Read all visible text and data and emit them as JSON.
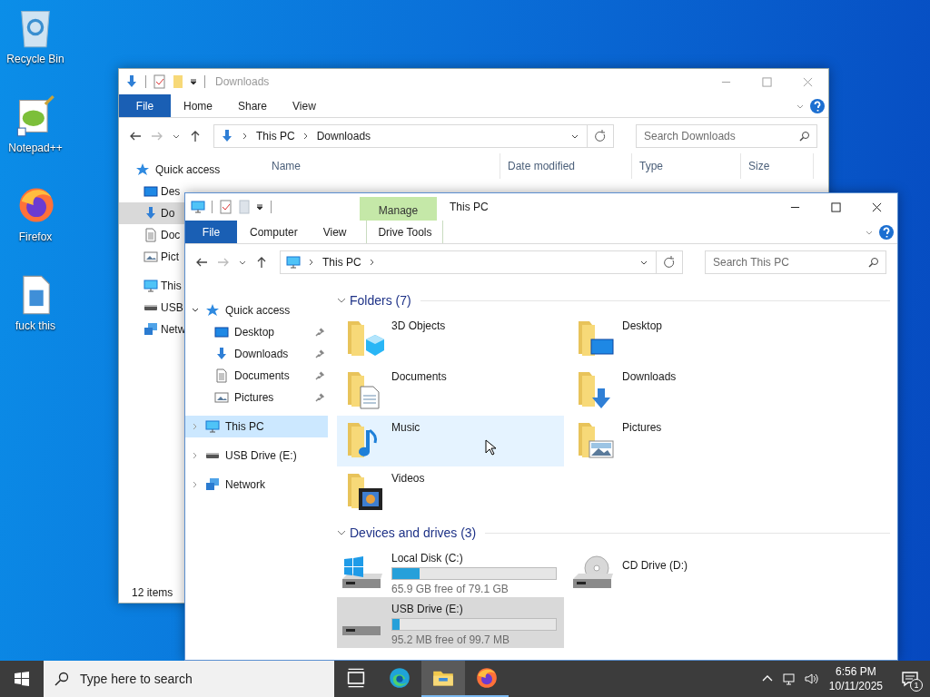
{
  "desktop_icons": [
    {
      "label": "Recycle Bin",
      "kind": "recycle"
    },
    {
      "label": "Notepad++",
      "kind": "notepad"
    },
    {
      "label": "Firefox",
      "kind": "firefox"
    },
    {
      "label": "fuck this",
      "kind": "file"
    }
  ],
  "back_window": {
    "title": "Downloads",
    "ribbon_tabs": [
      "File",
      "Home",
      "Share",
      "View"
    ],
    "address": [
      "This PC",
      "Downloads"
    ],
    "search": {
      "placeholder": "Search Downloads"
    },
    "columns": [
      "Name",
      "Date modified",
      "Type",
      "Size"
    ],
    "nav": [
      {
        "label": "Quick access",
        "kind": "star",
        "selected": false
      },
      {
        "label": "Des",
        "kind": "desktop",
        "selected": false
      },
      {
        "label": "Do",
        "kind": "download",
        "selected": true
      },
      {
        "label": "Doc",
        "kind": "document",
        "selected": false
      },
      {
        "label": "Pict",
        "kind": "picture",
        "selected": false
      },
      {
        "label": "This",
        "kind": "pc",
        "selected": false
      },
      {
        "label": "USB",
        "kind": "usb",
        "selected": false
      },
      {
        "label": "Netw",
        "kind": "network",
        "selected": false
      }
    ],
    "status": "12 items"
  },
  "front_window": {
    "title": "This PC",
    "context_group": "Manage",
    "ribbon_tabs": [
      "File",
      "Computer",
      "View"
    ],
    "context_tab": "Drive Tools",
    "address": [
      "This PC"
    ],
    "search": {
      "placeholder": "Search This PC"
    },
    "nav": [
      {
        "label": "Quick access",
        "kind": "star",
        "selected": false,
        "expanded": true,
        "children": [
          {
            "label": "Desktop",
            "kind": "desktop",
            "selected": false,
            "pinned": true
          },
          {
            "label": "Downloads",
            "kind": "download",
            "selected": false,
            "pinned": true
          },
          {
            "label": "Documents",
            "kind": "document",
            "selected": false,
            "pinned": true
          },
          {
            "label": "Pictures",
            "kind": "picture",
            "selected": false,
            "pinned": true
          }
        ]
      },
      {
        "label": "This PC",
        "kind": "pc",
        "selected": true,
        "expanded": false
      },
      {
        "label": "USB Drive (E:)",
        "kind": "usb",
        "selected": false,
        "expanded": false
      },
      {
        "label": "Network",
        "kind": "network",
        "selected": false,
        "expanded": false
      }
    ],
    "sections": [
      {
        "title": "Folders (7)",
        "kind": "folders",
        "expanded": true,
        "items": [
          {
            "label": "3D Objects",
            "kind": "objects",
            "hovered": false
          },
          {
            "label": "Desktop",
            "kind": "desktop",
            "hovered": false
          },
          {
            "label": "Documents",
            "kind": "document",
            "hovered": false
          },
          {
            "label": "Downloads",
            "kind": "download",
            "hovered": false
          },
          {
            "label": "Music",
            "kind": "music",
            "hovered": true
          },
          {
            "label": "Pictures",
            "kind": "picture",
            "hovered": false
          },
          {
            "label": "Videos",
            "kind": "video",
            "hovered": false
          }
        ]
      },
      {
        "title": "Devices and drives (3)",
        "kind": "drives",
        "expanded": true,
        "items": [
          {
            "label": "Local Disk (C:)",
            "kind": "system",
            "level": 0.167,
            "free": "65.9 GB free of 79.1 GB",
            "selected": false
          },
          {
            "label": "CD Drive (D:)",
            "kind": "cd",
            "selected": false
          },
          {
            "label": "USB Drive (E:)",
            "kind": "usb",
            "level": 0.045,
            "free": "95.2 MB free of 99.7 MB",
            "selected": true
          }
        ]
      }
    ]
  },
  "taskbar": {
    "search": {
      "placeholder": "Type here to search"
    },
    "apps": [
      {
        "kind": "taskview",
        "active": false,
        "running": false
      },
      {
        "kind": "edge",
        "active": false,
        "running": false
      },
      {
        "kind": "explorer",
        "active": true,
        "running": true
      },
      {
        "kind": "firefox",
        "active": false,
        "running": true
      }
    ],
    "time": "6:56 PM",
    "date": "10/11/2025",
    "notifications": "1"
  }
}
